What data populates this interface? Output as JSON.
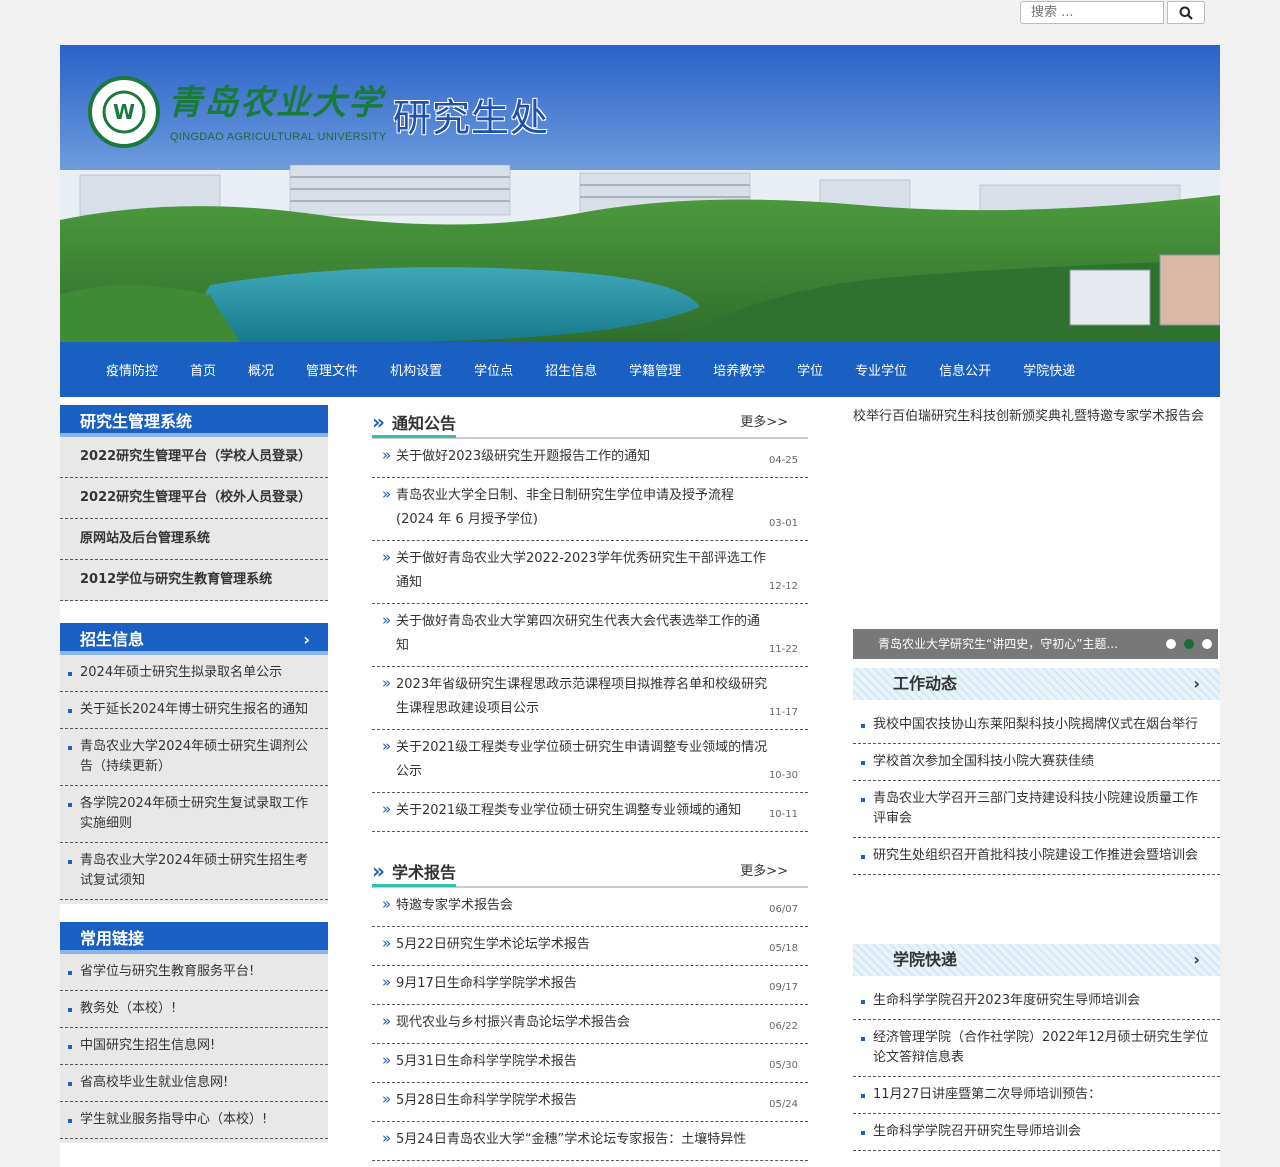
{
  "search": {
    "placeholder": "搜索 ..."
  },
  "header": {
    "university_cn": "青岛农业大学",
    "university_en": "QINGDAO AGRICULTURAL UNIVERSITY",
    "site_title": "研究生处"
  },
  "nav": [
    "疫情防控",
    "首页",
    "概况",
    "管理文件",
    "机构设置",
    "学位点",
    "招生信息",
    "学籍管理",
    "培养教学",
    "学位",
    "专业学位",
    "信息公开",
    "学院快递"
  ],
  "systems": {
    "title": "研究生管理系统",
    "items": [
      "2022研究生管理平台（学校人员登录）",
      "2022研究生管理平台（校外人员登录）",
      "原网站及后台管理系统",
      "2012学位与研究生教育管理系统"
    ]
  },
  "admissions": {
    "title": "招生信息",
    "items": [
      "2024年硕士研究生拟录取名单公示",
      "关于延长2024年博士研究生报名的通知",
      "青岛农业大学2024年硕士研究生调剂公告（持续更新）",
      "各学院2024年硕士研究生复试录取工作实施细则",
      "青岛农业大学2024年硕士研究生招生考试复试须知"
    ]
  },
  "links": {
    "title": "常用链接",
    "items": [
      "省学位与研究生教育服务平台!",
      "教务处（本校）!",
      "中国研究生招生信息网!",
      "省高校毕业生就业信息网!",
      "学生就业服务指导中心（本校）!"
    ]
  },
  "notices": {
    "title": "通知公告",
    "more": "更多>>",
    "items": [
      {
        "title": "关于做好2023级研究生开题报告工作的通知",
        "date": "04-25"
      },
      {
        "title": "青岛农业大学全日制、非全日制研究生学位申请及授予流程(2024 年 6 月授予学位)",
        "date": "03-01"
      },
      {
        "title": "关于做好青岛农业大学2022-2023学年优秀研究生干部评选工作通知",
        "date": "12-12"
      },
      {
        "title": "关于做好青岛农业大学第四次研究生代表大会代表选举工作的通知",
        "date": "11-22"
      },
      {
        "title": "2023年省级研究生课程思政示范课程项目拟推荐名单和校级研究生课程思政建设项目公示",
        "date": "11-17"
      },
      {
        "title": "关于2021级工程类专业学位硕士研究生申请调整专业领域的情况公示",
        "date": "10-30"
      },
      {
        "title": "关于2021级工程类专业学位硕士研究生调整专业领域的通知",
        "date": "10-11"
      }
    ]
  },
  "reports": {
    "title": "学术报告",
    "more": "更多>>",
    "items": [
      {
        "title": "特邀专家学术报告会",
        "date": "06/07"
      },
      {
        "title": "5月22日研究生学术论坛学术报告",
        "date": "05/18"
      },
      {
        "title": "9月17日生命科学学院学术报告",
        "date": "09/17"
      },
      {
        "title": "现代农业与乡村振兴青岛论坛学术报告会",
        "date": "06/22"
      },
      {
        "title": "5月31日生命科学学院学术报告",
        "date": "05/30"
      },
      {
        "title": "5月28日生命科学学院学术报告",
        "date": "05/24"
      },
      {
        "title": "5月24日青岛农业大学“金穗”学术论坛专家报告：土壤特异性",
        "date": ""
      }
    ]
  },
  "right": {
    "marquee": "校举行百伯瑞研究生科技创新颁奖典礼暨特邀专家学术报告会",
    "slider_caption": "青岛农业大学研究生“讲四史，守初心”主题...",
    "work": {
      "title": "工作动态",
      "items": [
        "我校中国农技协山东莱阳梨科技小院揭牌仪式在烟台举行",
        "学校首次参加全国科技小院大赛获佳绩",
        "青岛农业大学召开三部门支持建设科技小院建设质量工作评审会",
        "研究生处组织召开首批科技小院建设工作推进会暨培训会"
      ]
    },
    "college": {
      "title": "学院快递",
      "items": [
        "生命科学学院召开2023年度研究生导师培训会",
        "经济管理学院（合作社学院）2022年12月硕士研究生学位论文答辩信息表",
        "11月27日讲座暨第二次导师培训预告：",
        "生命科学学院召开研究生导师培训会"
      ]
    }
  }
}
